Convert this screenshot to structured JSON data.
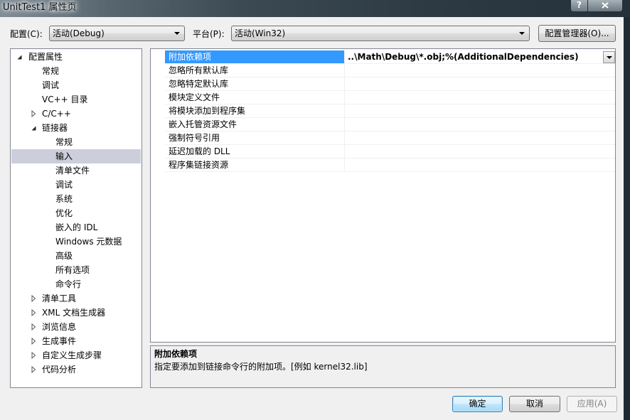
{
  "window": {
    "title": "UnitTest1 属性页"
  },
  "icons": {
    "help": "help-icon",
    "close": "close-icon",
    "combo_arrow": "chevron-down-icon",
    "expanded": "expanded-arrow-icon",
    "collapsed": "collapsed-arrow-icon"
  },
  "colors": {
    "tree_selection": "#cccedb",
    "grid_selection": "#3399ff",
    "grid_selection_text": "#ffffff",
    "panel_border": "#828790",
    "dialog_background": "#f0f0f0",
    "default_button_border": "#3c7fb1"
  },
  "config_bar": {
    "configuration_label": "配置(C):",
    "configuration_value": "活动(Debug)",
    "platform_label": "平台(P):",
    "platform_value": "活动(Win32)",
    "configuration_manager_button": "配置管理器(O)..."
  },
  "tree": {
    "items": [
      {
        "label": "配置属性",
        "level": 0,
        "expander": "expanded"
      },
      {
        "label": "常规",
        "level": 1,
        "expander": "none"
      },
      {
        "label": "调试",
        "level": 1,
        "expander": "none"
      },
      {
        "label": "VC++ 目录",
        "level": 1,
        "expander": "none"
      },
      {
        "label": "C/C++",
        "level": 1,
        "expander": "collapsed"
      },
      {
        "label": "链接器",
        "level": 1,
        "expander": "expanded"
      },
      {
        "label": "常规",
        "level": 2,
        "expander": "none"
      },
      {
        "label": "输入",
        "level": 2,
        "expander": "none",
        "selected": true
      },
      {
        "label": "清单文件",
        "level": 2,
        "expander": "none"
      },
      {
        "label": "调试",
        "level": 2,
        "expander": "none"
      },
      {
        "label": "系统",
        "level": 2,
        "expander": "none"
      },
      {
        "label": "优化",
        "level": 2,
        "expander": "none"
      },
      {
        "label": "嵌入的 IDL",
        "level": 2,
        "expander": "none"
      },
      {
        "label": "Windows 元数据",
        "level": 2,
        "expander": "none"
      },
      {
        "label": "高级",
        "level": 2,
        "expander": "none"
      },
      {
        "label": "所有选项",
        "level": 2,
        "expander": "none"
      },
      {
        "label": "命令行",
        "level": 2,
        "expander": "none"
      },
      {
        "label": "清单工具",
        "level": 1,
        "expander": "collapsed"
      },
      {
        "label": "XML 文档生成器",
        "level": 1,
        "expander": "collapsed"
      },
      {
        "label": "浏览信息",
        "level": 1,
        "expander": "collapsed"
      },
      {
        "label": "生成事件",
        "level": 1,
        "expander": "collapsed"
      },
      {
        "label": "自定义生成步骤",
        "level": 1,
        "expander": "collapsed"
      },
      {
        "label": "代码分析",
        "level": 1,
        "expander": "collapsed"
      }
    ]
  },
  "grid": {
    "rows": [
      {
        "name": "附加依赖项",
        "value": "..\\Math\\Debug\\*.obj;%(AdditionalDependencies)",
        "selected": true,
        "modified": true
      },
      {
        "name": "忽略所有默认库",
        "value": ""
      },
      {
        "name": "忽略特定默认库",
        "value": ""
      },
      {
        "name": "模块定义文件",
        "value": ""
      },
      {
        "name": "将模块添加到程序集",
        "value": ""
      },
      {
        "name": "嵌入托管资源文件",
        "value": ""
      },
      {
        "name": "强制符号引用",
        "value": ""
      },
      {
        "name": "延迟加载的 DLL",
        "value": ""
      },
      {
        "name": "程序集链接资源",
        "value": ""
      }
    ]
  },
  "description": {
    "title": "附加依赖项",
    "text": "指定要添加到链接命令行的附加项。[例如 kernel32.lib]"
  },
  "buttons": {
    "ok": "确定",
    "cancel": "取消",
    "apply": "应用(A)"
  }
}
